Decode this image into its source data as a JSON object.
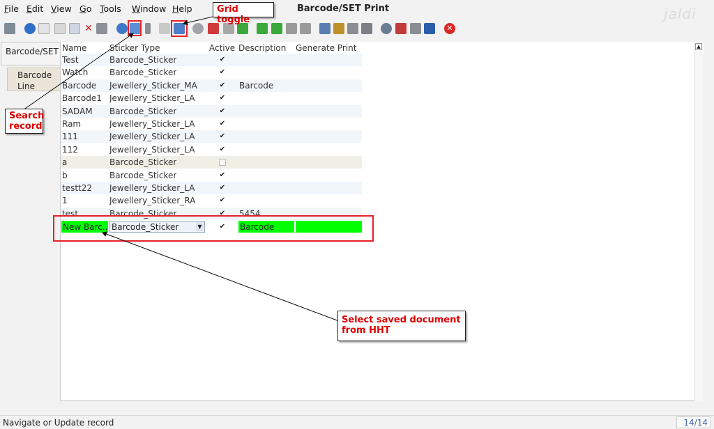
{
  "menu": [
    "File",
    "Edit",
    "View",
    "Go",
    "Tools",
    "Window",
    "Help"
  ],
  "menu_mnemonic_underlined": [
    "F",
    "E",
    "V",
    "G",
    "T",
    "W",
    "H"
  ],
  "window_title": "Barcode/SET Print",
  "logo_text": "jaldi",
  "tabs": [
    {
      "label": "Barcode/SET"
    },
    {
      "label_line1": "Barcode",
      "label_line2": "Line"
    }
  ],
  "grid": {
    "columns": [
      "Name",
      "Sticker Type",
      "Active",
      "Description",
      "Generate Print"
    ],
    "rows": [
      {
        "name": "Test",
        "sticker": "Barcode_Sticker",
        "active": true,
        "description": ""
      },
      {
        "name": "Watch",
        "sticker": "Barcode_Sticker",
        "active": true,
        "description": ""
      },
      {
        "name": "Barcode",
        "sticker": "Jewellery_Sticker_MA",
        "active": true,
        "description": "Barcode"
      },
      {
        "name": "Barcode1",
        "sticker": "Jewellery_Sticker_LA",
        "active": true,
        "description": ""
      },
      {
        "name": "SADAM",
        "sticker": "Barcode_Sticker",
        "active": true,
        "description": ""
      },
      {
        "name": "Ram",
        "sticker": "Jewellery_Sticker_LA",
        "active": true,
        "description": ""
      },
      {
        "name": "111",
        "sticker": "Jewellery_Sticker_LA",
        "active": true,
        "description": ""
      },
      {
        "name": "112",
        "sticker": "Jewellery_Sticker_LA",
        "active": true,
        "description": ""
      },
      {
        "name": "a",
        "sticker": "Barcode_Sticker",
        "active": false,
        "description": ""
      },
      {
        "name": "b",
        "sticker": "Barcode_Sticker",
        "active": true,
        "description": ""
      },
      {
        "name": "testt22",
        "sticker": "Jewellery_Sticker_LA",
        "active": true,
        "description": ""
      },
      {
        "name": "1",
        "sticker": "Jewellery_Sticker_RA",
        "active": true,
        "description": ""
      },
      {
        "name": "test",
        "sticker": "Barcode_Sticker",
        "active": true,
        "description": "5454"
      }
    ],
    "edit_row": {
      "name": "New Barc...",
      "sticker": "Barcode_Sticker",
      "active": true,
      "description": "Barcode"
    }
  },
  "annotations": {
    "grid_toggle": "Grid toggle",
    "search_line1": "Search",
    "search_line2": "record",
    "select_line1": "Select saved document",
    "select_line2": "from HHT"
  },
  "status": {
    "text": "Navigate or Update record",
    "count": "14/14"
  },
  "colors": {
    "highlight_green": "#00ff00",
    "annotation_red": "#e00000",
    "box_red": "#e8202a"
  }
}
